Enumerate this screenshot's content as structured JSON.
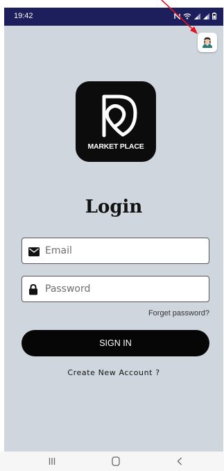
{
  "status_bar": {
    "time": "19:42",
    "icons": [
      "nfc-icon",
      "wifi-icon",
      "signal-icon",
      "signal-icon",
      "battery-icon"
    ]
  },
  "header": {
    "profile_icon": "user-avatar-icon"
  },
  "logo": {
    "text": "MARKET PLACE",
    "icon": "location-pin-d-icon"
  },
  "page": {
    "title": "Login"
  },
  "form": {
    "email_placeholder": "Email",
    "email_icon": "envelope-icon",
    "password_placeholder": "Password",
    "password_icon": "lock-icon",
    "forgot_label": "Forget password?",
    "signin_label": "SIGN IN",
    "create_label": "Create New Account ?"
  },
  "nav_bar": {
    "icons": [
      "recents-icon",
      "home-icon",
      "back-icon"
    ]
  },
  "colors": {
    "status_bar": "#1d1f5c",
    "background": "#cfd6dd",
    "primary_button": "#060606",
    "annotation_arrow": "#e0141e"
  }
}
